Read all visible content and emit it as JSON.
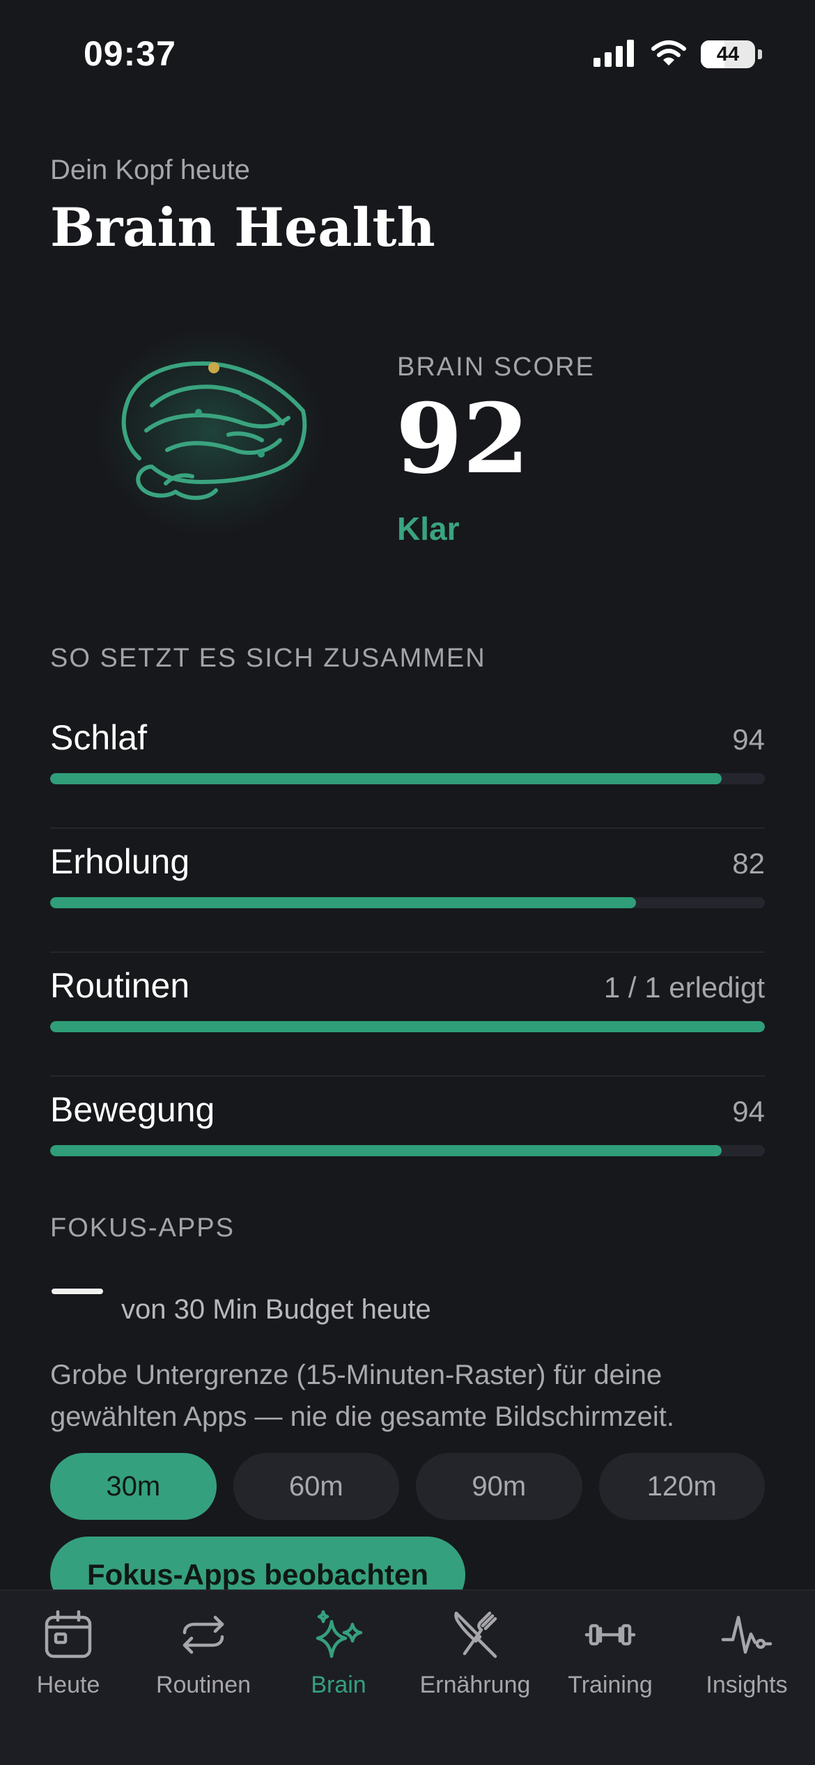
{
  "status_bar": {
    "time": "09:37",
    "battery": "44",
    "battery_level": 0.44
  },
  "header": {
    "eyebrow": "Dein Kopf heute",
    "title": "Brain Health"
  },
  "score": {
    "label": "BRAIN SCORE",
    "value": "92",
    "status": "Klar"
  },
  "composition": {
    "section_label": "SO SETZT ES SICH ZUSAMMEN",
    "metrics": [
      {
        "name": "Schlaf",
        "value": "94",
        "progress": 0.94
      },
      {
        "name": "Erholung",
        "value": "82",
        "progress": 0.82
      },
      {
        "name": "Routinen",
        "value": "1 / 1 erledigt",
        "progress": 1.0
      },
      {
        "name": "Bewegung",
        "value": "94",
        "progress": 0.94
      }
    ]
  },
  "focus": {
    "section_label": "FOKUS-APPS",
    "budget_text": "von 30 Min Budget heute",
    "note": "Grobe Untergrenze (15-Minuten-Raster) für deine gewählten Apps — nie die gesamte Bildschirmzeit.",
    "budget_options": [
      "30m",
      "60m",
      "90m",
      "120m"
    ],
    "selected_option": "30m",
    "cta_label": "Fokus-Apps beobachten"
  },
  "tabbar": {
    "items": [
      {
        "label": "Heute",
        "icon": "calendar-icon"
      },
      {
        "label": "Routinen",
        "icon": "repeat-icon"
      },
      {
        "label": "Brain",
        "icon": "sparkles-icon",
        "active": true
      },
      {
        "label": "Ernährung",
        "icon": "utensils-icon"
      },
      {
        "label": "Training",
        "icon": "dumbbell-icon"
      },
      {
        "label": "Insights",
        "icon": "activity-icon"
      }
    ]
  },
  "colors": {
    "background": "#17181c",
    "accent": "#35a07e",
    "text": "#f2f2f0",
    "muted": "#a6a6aa"
  }
}
